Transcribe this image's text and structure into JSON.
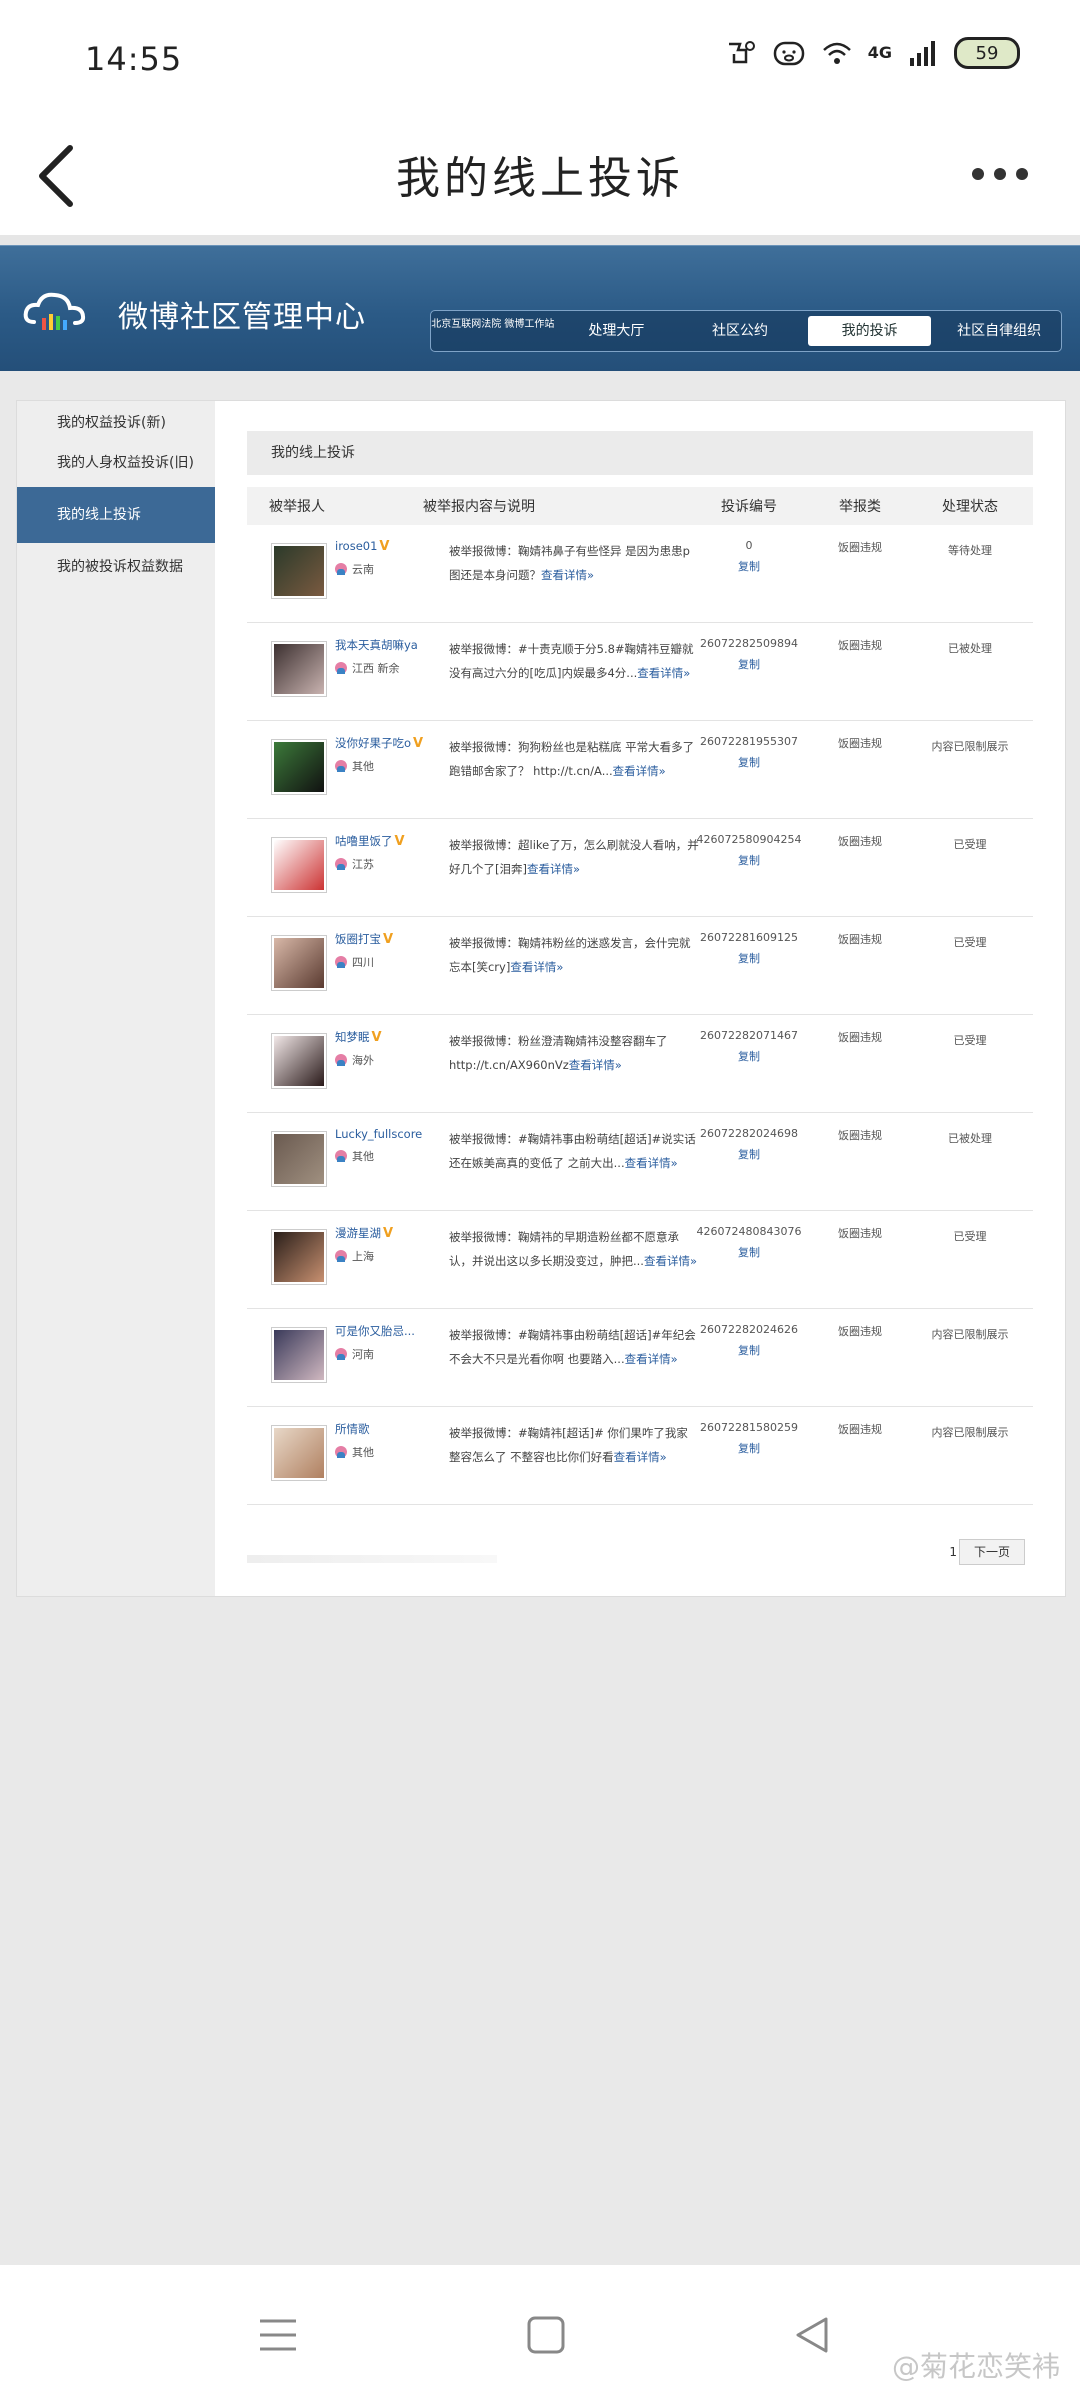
{
  "status_bar": {
    "time": "14:55",
    "network": "4G",
    "battery": "59"
  },
  "app_header": {
    "title": "我的线上投诉"
  },
  "banner": {
    "brand": "微博社区管理中心",
    "nav": [
      {
        "label": "北京互联网法院 微博工作站"
      },
      {
        "label": "处理大厅"
      },
      {
        "label": "社区公约"
      },
      {
        "label": "我的投诉"
      },
      {
        "label": "社区自律组织"
      }
    ]
  },
  "sidebar": {
    "items": [
      {
        "label": "我的权益投诉(新)"
      },
      {
        "label": "我的人身权益投诉(旧)"
      },
      {
        "label": "我的线上投诉"
      },
      {
        "label": "我的被投诉权益数据"
      }
    ]
  },
  "main": {
    "title": "我的线上投诉",
    "columns": [
      "被举报人",
      "被举报内容与说明",
      "投诉编号",
      "举报类",
      "处理状态"
    ],
    "rows": [
      {
        "name": "irose01",
        "verified": true,
        "location": "云南",
        "desc": "被举报微博：鞠婧祎鼻子有些怪异 是因为患患p图还是本身问题？",
        "link": "查看详情»",
        "number": "0",
        "copy": "复制",
        "type": "饭圈违规",
        "status": "等待处理",
        "av1": "#2b3a2a",
        "av2": "#7a5a40"
      },
      {
        "name": "我本天真胡嘛ya",
        "verified": false,
        "location": "江西 新余",
        "desc": "被举报微博：#十责克顺于分5.8#鞠婧祎豆瓣就没有高过六分的[吃瓜]内娱最多4分...",
        "link": "查看详情»",
        "number": "26072282509894",
        "copy": "复制",
        "type": "饭圈违规",
        "status": "已被处理",
        "av1": "#3c3030",
        "av2": "#c9b3b0"
      },
      {
        "name": "没你好果子吃o",
        "verified": true,
        "location": "其他",
        "desc": "被举报微博：狗狗粉丝也是粘糕底 平常大看多了跑错邮舍家了？ http://t.cn/A...",
        "link": "查看详情»",
        "number": "26072281955307",
        "copy": "复制",
        "type": "饭圈违规",
        "status": "内容已限制展示",
        "av1": "#3c7a3a",
        "av2": "#111111"
      },
      {
        "name": "咕噜里饭了",
        "verified": true,
        "location": "江苏",
        "desc": "被举报微博：超like了万，怎么刷就没人看呐，并好几个了[泪奔]",
        "link": "查看详情»",
        "number": "426072580904254",
        "copy": "复制",
        "type": "饭圈违规",
        "status": "已受理",
        "av1": "#ffffff",
        "av2": "#cc3333"
      },
      {
        "name": "饭圈打宝",
        "verified": true,
        "location": "四川",
        "desc": "被举报微博：鞠婧祎粉丝的迷惑发言，会什完就忘本[笑cry]",
        "link": "查看详情»",
        "number": "26072281609125",
        "copy": "复制",
        "type": "饭圈违规",
        "status": "已受理",
        "av1": "#d8b8a8",
        "av2": "#5a3a30"
      },
      {
        "name": "知梦眠",
        "verified": true,
        "location": "海外",
        "desc": "被举报微博：粉丝澄清鞠婧祎没整容翻车了 http://t.cn/AX960nVz",
        "link": "查看详情»",
        "number": "26072282071467",
        "copy": "复制",
        "type": "饭圈违规",
        "status": "已受理",
        "av1": "#f2e8e8",
        "av2": "#2a1a1a"
      },
      {
        "name": "Lucky_fullscore",
        "verified": false,
        "location": "其他",
        "desc": "被举报微博：#鞠婧祎事由粉萌结[超话]#说实话还在嫉美高真的变低了 之前大出...",
        "link": "查看详情»",
        "number": "26072282024698",
        "copy": "复制",
        "type": "饭圈违规",
        "status": "已被处理",
        "av1": "#6a5a50",
        "av2": "#a09080"
      },
      {
        "name": "漫游星湖",
        "verified": true,
        "location": "上海",
        "desc": "被举报微博：鞠婧祎的早期造粉丝都不愿意承认，并说出这以多长期没变过，肿把...",
        "link": "查看详情»",
        "number": "426072480843076",
        "copy": "复制",
        "type": "饭圈违规",
        "status": "已受理",
        "av1": "#2a1f1a",
        "av2": "#c89070"
      },
      {
        "name": "可是你又胎忌...",
        "verified": false,
        "location": "河南",
        "desc": "被举报微博：#鞠婧祎事由粉萌结[超话]#年纪会不会大不只是光看你啊 也要踏入...",
        "link": "查看详情»",
        "number": "26072282024626",
        "copy": "复制",
        "type": "饭圈违规",
        "status": "内容已限制展示",
        "av1": "#3a3a5a",
        "av2": "#d0b8c0"
      },
      {
        "name": "所情歌",
        "verified": false,
        "location": "其他",
        "desc": "被举报微博：#鞠婧祎[超话]# 你们果咋了我家整容怎么了 不整容也比你们好看",
        "link": "查看详情»",
        "number": "26072281580259",
        "copy": "复制",
        "type": "饭圈违规",
        "status": "内容已限制展示",
        "av1": "#e8d8c8",
        "av2": "#b08060"
      }
    ],
    "pager": {
      "page": "1",
      "next": "下一页"
    }
  },
  "watermark": "@菊花恋笑袆"
}
